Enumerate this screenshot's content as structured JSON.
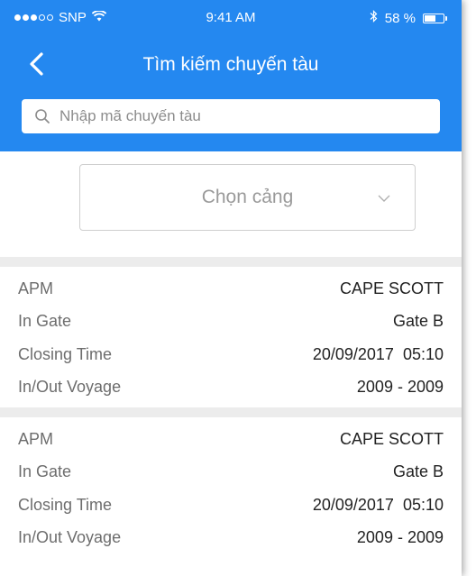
{
  "status_bar": {
    "carrier": "SNP",
    "time": "9:41 AM",
    "battery": "58 %",
    "battery_level": 0.58,
    "signal_bars": 3
  },
  "nav": {
    "title": "Tìm kiếm chuyến tàu",
    "back_icon": "chevron-left-icon"
  },
  "search": {
    "placeholder": "Nhập mã chuyến tàu",
    "value": ""
  },
  "port_select": {
    "label": "Chọn cảng"
  },
  "voyages": [
    {
      "rows": [
        {
          "label": "APM",
          "value": "CAPE SCOTT"
        },
        {
          "label": "In Gate",
          "value": "Gate B"
        },
        {
          "label": "Closing Time",
          "value": "20/09/2017  05:10"
        },
        {
          "label": "In/Out Voyage",
          "value": "2009 - 2009"
        }
      ]
    },
    {
      "rows": [
        {
          "label": "APM",
          "value": "CAPE SCOTT"
        },
        {
          "label": "In Gate",
          "value": "Gate B"
        },
        {
          "label": "Closing Time",
          "value": "20/09/2017  05:10"
        },
        {
          "label": "In/Out Voyage",
          "value": "2009 - 2009"
        }
      ]
    }
  ],
  "colors": {
    "header": "#2488f0",
    "separator": "#ececec",
    "label_text": "#6d6d6d",
    "value_text": "#222222"
  }
}
